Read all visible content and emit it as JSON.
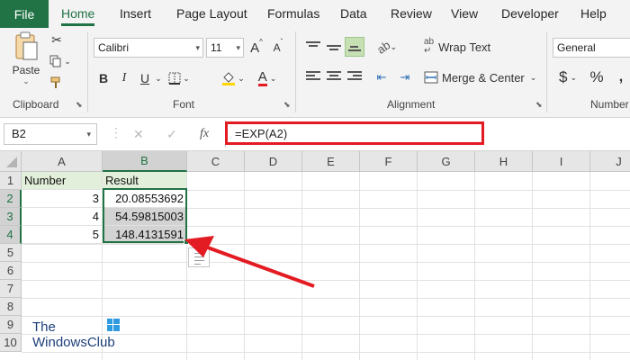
{
  "menu": {
    "file": "File",
    "tabs": [
      "Home",
      "Insert",
      "Page Layout",
      "Formulas",
      "Data",
      "Review",
      "View",
      "Developer",
      "Help"
    ]
  },
  "ribbon": {
    "clipboard": {
      "paste": "Paste",
      "label": "Clipboard"
    },
    "font": {
      "name": "Calibri",
      "size": "11",
      "grow": "A",
      "shrink": "A",
      "bold": "B",
      "italic": "I",
      "underline": "U",
      "font_color_letter": "A",
      "label": "Font"
    },
    "alignment": {
      "wrap_text": "Wrap Text",
      "merge_center": "Merge & Center",
      "label": "Alignment"
    },
    "number": {
      "format": "General",
      "currency": "$",
      "percent": "%",
      "label": "Number"
    }
  },
  "formula_bar": {
    "name_box": "B2",
    "fx": "fx",
    "cancel": "✕",
    "enter": "✓",
    "formula": "=EXP(A2)"
  },
  "sheet": {
    "columns": [
      "A",
      "B",
      "C",
      "D",
      "E",
      "F",
      "G",
      "H",
      "I",
      "J"
    ],
    "rows": [
      "1",
      "2",
      "3",
      "4",
      "5",
      "6",
      "7",
      "8",
      "9",
      "10"
    ],
    "cells": {
      "A1": "Number",
      "B1": "Result",
      "A2": "3",
      "B2": "20.08553692",
      "A3": "4",
      "B3": "54.59815003",
      "A4": "5",
      "B4": "148.4131591"
    }
  },
  "watermark": {
    "line1": "The",
    "line2": "WindowsClub"
  },
  "colors": {
    "excel_green": "#217346",
    "highlight_red": "#e31b23",
    "header_fill": "#e2efda"
  },
  "icons": [
    "paste-icon",
    "cut-icon",
    "copy-icon",
    "format-painter-icon",
    "fill-color-icon",
    "borders-icon",
    "wrap-text-icon",
    "merge-center-icon",
    "fx-icon",
    "quick-analysis-icon",
    "windows-logo-icon"
  ]
}
